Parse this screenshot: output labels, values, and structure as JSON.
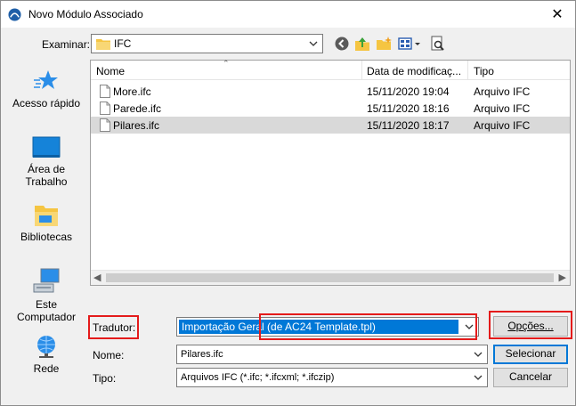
{
  "window": {
    "title": "Novo Módulo Associado",
    "close_glyph": "✕"
  },
  "toolbar": {
    "lookin_label": "Examinar:",
    "lookin_value": "IFC",
    "icons": [
      "back-icon",
      "up-folder-icon",
      "new-folder-icon",
      "view-menu-icon",
      "preview-icon"
    ]
  },
  "places": [
    {
      "label": "Acesso rápido",
      "icon": "quick-access-star-icon"
    },
    {
      "label": "Área de Trabalho",
      "icon": "desktop-icon"
    },
    {
      "label": "Bibliotecas",
      "icon": "libraries-icon"
    },
    {
      "label": "Este Computador",
      "icon": "computer-icon"
    },
    {
      "label": "Rede",
      "icon": "network-icon"
    }
  ],
  "filelist": {
    "columns": [
      "Nome",
      "Data de modificaç...",
      "Tipo"
    ],
    "rows": [
      {
        "name": "More.ifc",
        "date": "15/11/2020 19:04",
        "type": "Arquivo IFC",
        "selected": false
      },
      {
        "name": "Parede.ifc",
        "date": "15/11/2020 18:16",
        "type": "Arquivo IFC",
        "selected": false
      },
      {
        "name": "Pilares.ifc",
        "date": "15/11/2020 18:17",
        "type": "Arquivo IFC",
        "selected": true
      }
    ]
  },
  "form": {
    "translator_label": "Tradutor:",
    "translator_value": "Importação Geral (de AC24 Template.tpl)",
    "options_label": "Opções...",
    "name_label": "Nome:",
    "name_value": "Pilares.ifc",
    "type_label": "Tipo:",
    "type_value": "Arquivos IFC (*.ifc; *.ifcxml; *.ifczip)",
    "select_label": "Selecionar",
    "cancel_label": "Cancelar"
  },
  "colors": {
    "selection_blue": "#0078d7",
    "annotation_red": "#e41b1b",
    "selected_row": "#d9d9d9"
  }
}
